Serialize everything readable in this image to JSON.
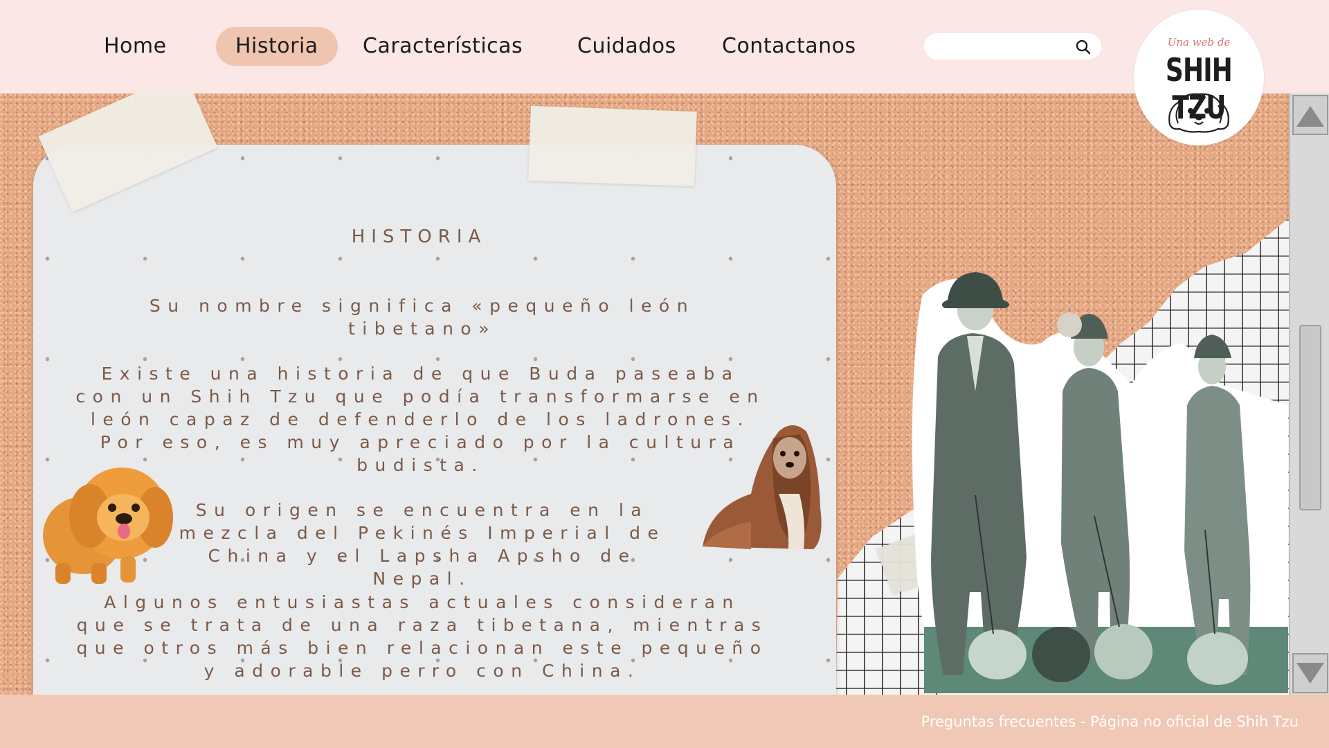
{
  "nav": {
    "items": [
      {
        "label": "Home",
        "active": false
      },
      {
        "label": "Historia",
        "active": true
      },
      {
        "label": "Características",
        "active": false
      },
      {
        "label": "Cuidados",
        "active": false
      },
      {
        "label": "Contactanos",
        "active": false
      }
    ],
    "search_placeholder": "",
    "search_icon": "search-icon"
  },
  "logo": {
    "script_text": "Una web de",
    "brand_text": "SHIH TZU"
  },
  "content": {
    "title": "HISTORIA",
    "paragraphs": [
      "Su nombre significa «pequeño león tibetano»",
      "Existe una historia de que Buda paseaba con un Shih Tzu que podía transformarse en león capaz de defenderlo de los ladrones. Por eso, es muy apreciado por la cultura budista.",
      "Su origen se encuentra en la mezcla del Pekinés Imperial de China y el Lapsha Apsho de Nepal.",
      "Algunos entusiastas actuales consideran que se trata de una raza tibetana, mientras que otros más bien relacionan este pequeño y adorable perro con China."
    ]
  },
  "footer": {
    "text": "Preguntas frecuentes - Página no oficial de Shih Tzu"
  },
  "colors": {
    "header_bg": "#fae7e6",
    "nav_active": "#efc5b0",
    "cork": "#e4a884",
    "text_brown": "#7a5a48",
    "footer_bg": "#f0c8b5"
  }
}
